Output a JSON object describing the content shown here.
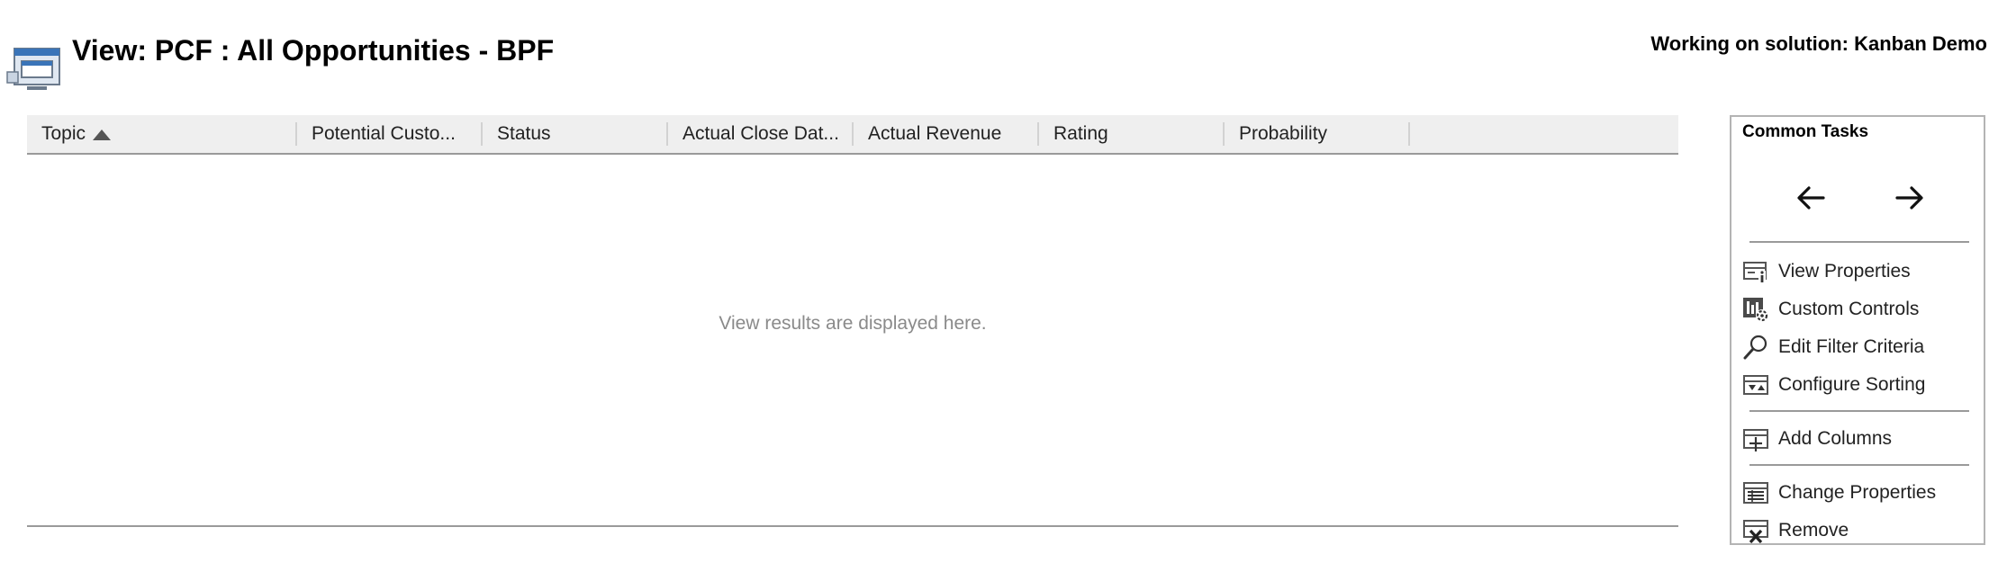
{
  "header": {
    "title": "View: PCF : All Opportunities - BPF",
    "solution": "Working on solution: Kanban Demo"
  },
  "grid": {
    "columns": [
      {
        "label": "Topic",
        "sorted": "ascending"
      },
      {
        "label": "Potential Custo..."
      },
      {
        "label": "Status"
      },
      {
        "label": "Actual Close Dat..."
      },
      {
        "label": "Actual Revenue"
      },
      {
        "label": "Rating"
      },
      {
        "label": "Probability"
      }
    ],
    "empty_message": "View results are displayed here."
  },
  "common_tasks": {
    "title": "Common Tasks",
    "nav": {
      "back_icon": "arrow-left-icon",
      "forward_icon": "arrow-right-icon"
    },
    "items": [
      {
        "label": "View Properties",
        "icon": "view-properties-icon"
      },
      {
        "label": "Custom Controls",
        "icon": "custom-controls-icon"
      },
      {
        "label": "Edit Filter Criteria",
        "icon": "edit-filter-icon"
      },
      {
        "label": "Configure Sorting",
        "icon": "configure-sorting-icon"
      },
      {
        "label": "Add Columns",
        "icon": "add-columns-icon"
      },
      {
        "label": "Change Properties",
        "icon": "change-properties-icon"
      },
      {
        "label": "Remove",
        "icon": "remove-icon"
      }
    ]
  },
  "colors": {
    "header_bg": "#efefef",
    "border": "#9a9a9a",
    "muted_text": "#8a8a8a",
    "icon_blue": "#2f6fb5"
  }
}
